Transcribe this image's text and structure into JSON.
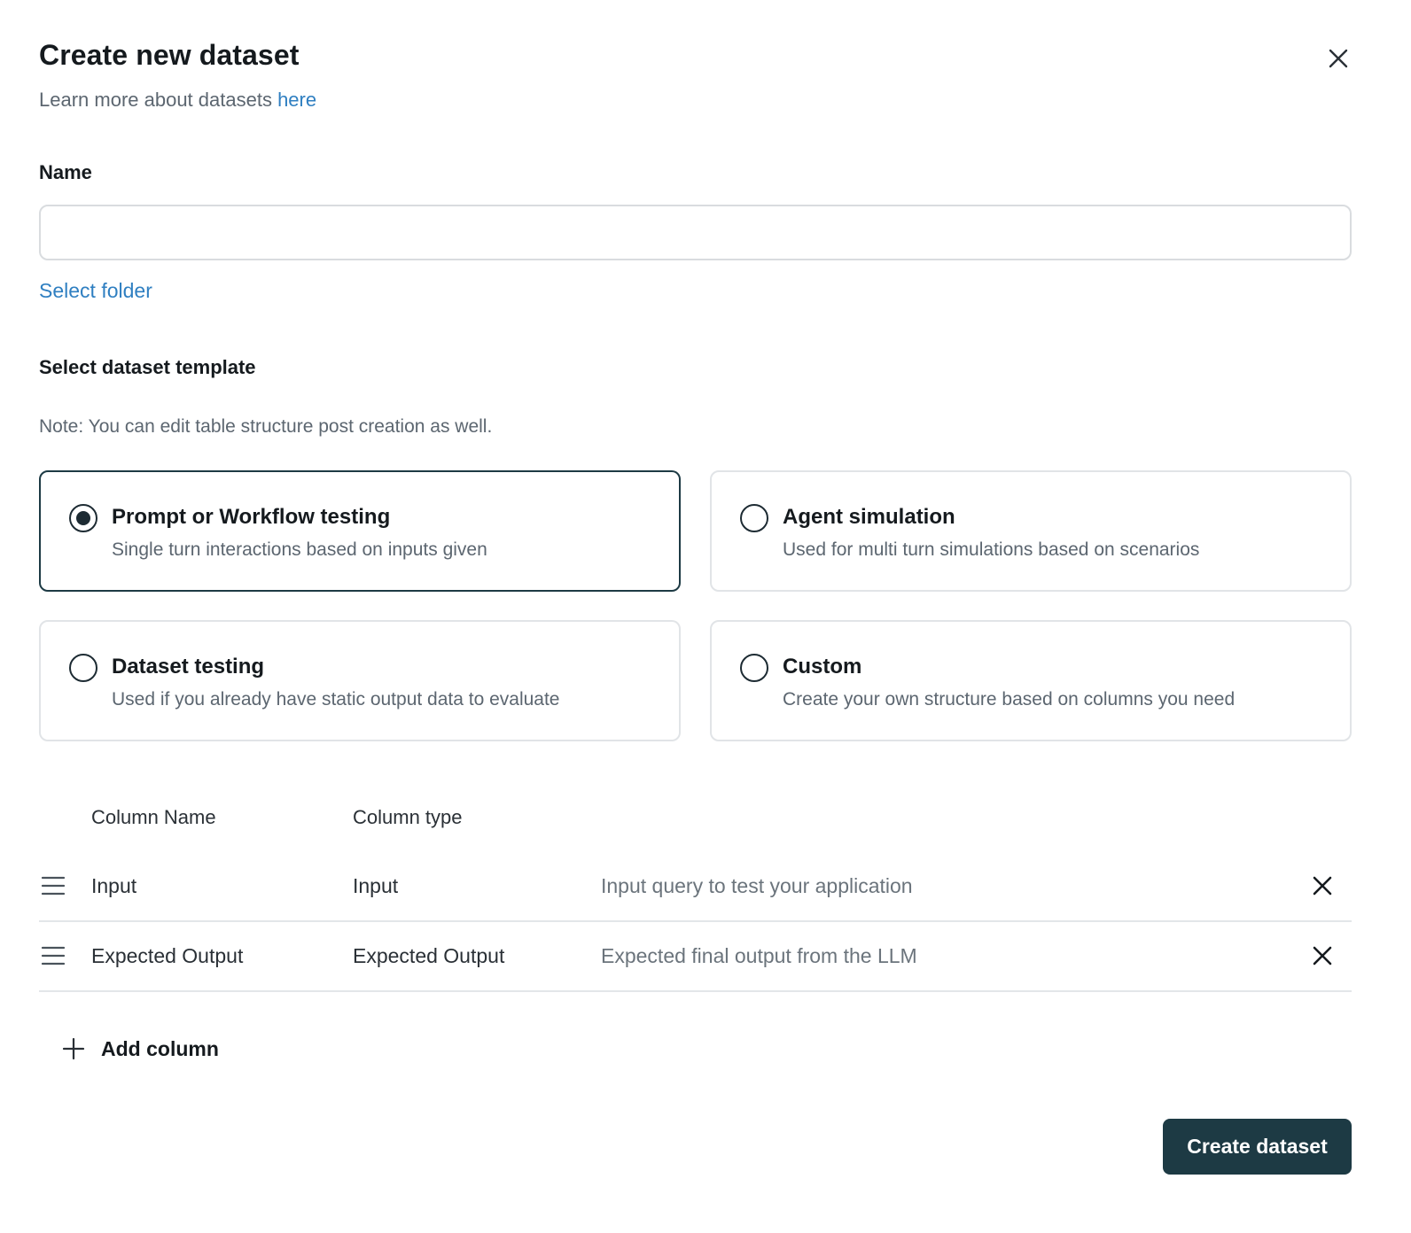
{
  "dialog": {
    "title": "Create new dataset",
    "subtitle_prefix": "Learn more about datasets ",
    "subtitle_link": "here",
    "close_icon": "close-icon"
  },
  "name_field": {
    "label": "Name",
    "value": "",
    "placeholder": ""
  },
  "select_folder_label": "Select folder",
  "template_section": {
    "title": "Select dataset template",
    "note": "Note: You can edit table structure post creation as well.",
    "selected": "Prompt or Workflow testing",
    "options": [
      {
        "title": "Prompt or Workflow testing",
        "description": "Single turn interactions based on inputs given",
        "selected": true
      },
      {
        "title": "Agent simulation",
        "description": "Used for multi turn simulations based on scenarios",
        "selected": false
      },
      {
        "title": "Dataset testing",
        "description": "Used if you already have static output data to evaluate",
        "selected": false
      },
      {
        "title": "Custom",
        "description": "Create your own structure based on columns you need",
        "selected": false
      }
    ]
  },
  "columns_table": {
    "headers": {
      "name": "Column Name",
      "type": "Column type"
    },
    "rows": [
      {
        "name": "Input",
        "type": "Input",
        "description": "Input query to test your application"
      },
      {
        "name": "Expected Output",
        "type": "Expected Output",
        "description": "Expected final output from the LLM"
      }
    ],
    "add_column_label": "Add column"
  },
  "footer": {
    "create_label": "Create dataset"
  },
  "colors": {
    "primary": "#1d3a44",
    "link": "#2f7fc1",
    "muted_text": "#5c6670",
    "border": "#e1e4e7"
  }
}
